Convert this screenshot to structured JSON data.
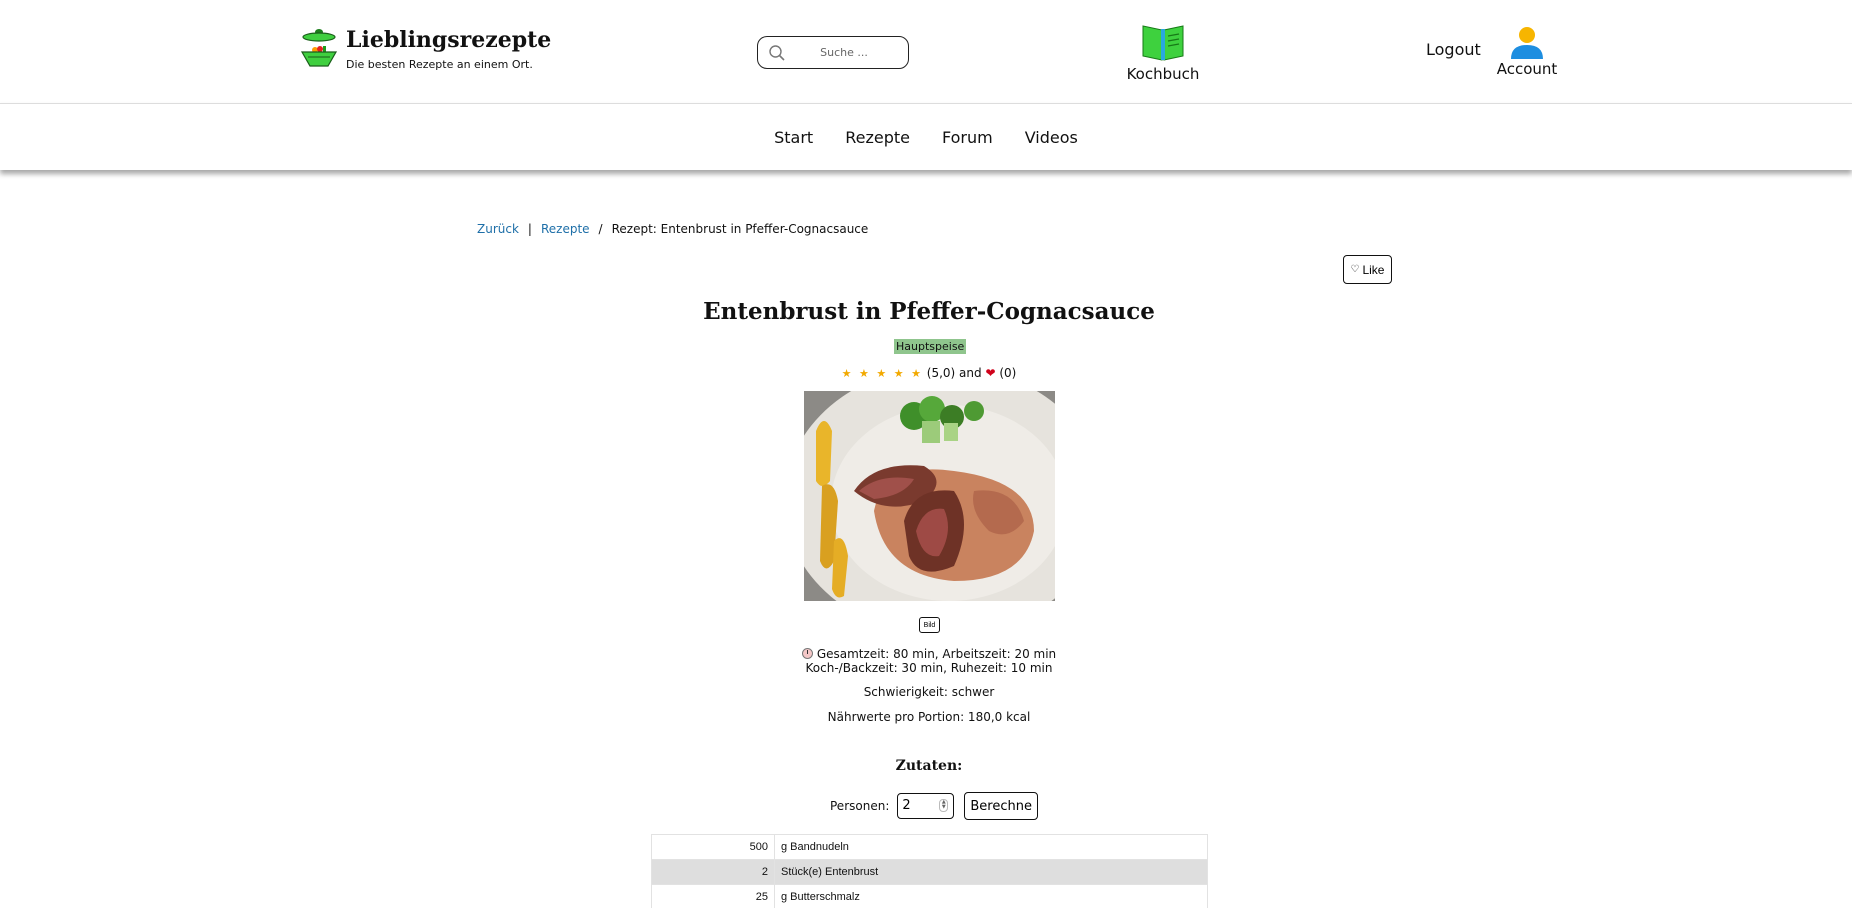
{
  "header": {
    "site_title": "Lieblingsrezepte",
    "tagline": "Die besten Rezepte an einem Ort.",
    "search_placeholder": "Suche ...",
    "kochbuch_label": "Kochbuch",
    "logout_label": "Logout",
    "account_label": "Account"
  },
  "nav": {
    "items": [
      {
        "label": "Start"
      },
      {
        "label": "Rezepte"
      },
      {
        "label": "Forum"
      },
      {
        "label": "Videos"
      }
    ]
  },
  "breadcrumb": {
    "back": "Zurück",
    "sep1": "|",
    "recipes": "Rezepte",
    "sep2": "/",
    "current": "Rezept: Entenbrust in Pfeffer-Cognacsauce"
  },
  "like_label": "Like",
  "recipe": {
    "title": "Entenbrust in Pfeffer-Cognacsauce",
    "category": "Hauptspeise",
    "stars": "★ ★ ★ ★ ★",
    "rating_value": "(5,0)",
    "rating_and": "and",
    "likes_count": "(0)",
    "image_button": "Bild",
    "times_line1": "Gesamtzeit: 80 min, Arbeitszeit: 20 min",
    "times_line2": "Koch-/Backzeit: 30 min, Ruhezeit: 10 min",
    "difficulty": "Schwierigkeit: schwer",
    "nutrition": "Nährwerte pro Portion: 180,0 kcal"
  },
  "ingredients": {
    "title": "Zutaten:",
    "persons_label": "Personen:",
    "persons_value": "2",
    "calc_button": "Berechne",
    "rows": [
      {
        "qty": "500",
        "item": "g Bandnudeln"
      },
      {
        "qty": "2",
        "item": "Stück(e) Entenbrust"
      },
      {
        "qty": "25",
        "item": "g Butterschmalz"
      }
    ]
  },
  "colors": {
    "link": "#1e6fa8",
    "category_bg": "#8fc58d",
    "star": "#f2a900",
    "heart": "#d0021b",
    "row_alt": "#dedede"
  },
  "icons": [
    "pot-icon",
    "search-icon",
    "book-icon",
    "account-icon",
    "heart-icon",
    "clock-icon"
  ]
}
